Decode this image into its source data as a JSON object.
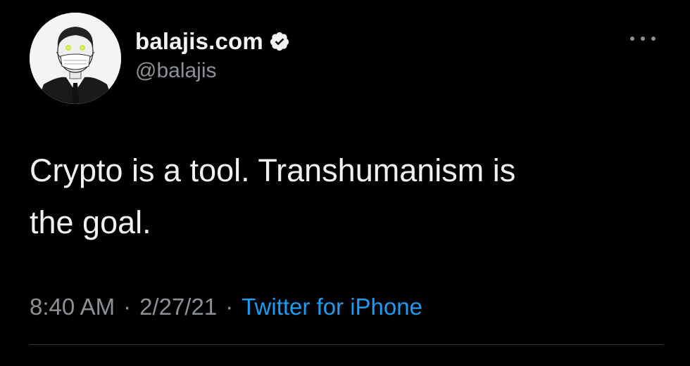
{
  "tweet": {
    "display_name": "balajis.com",
    "handle": "@balajis",
    "verified": true,
    "text_line1": "Crypto is a tool. Transhumanism is",
    "text_line2": "the goal.",
    "time": "8:40 AM",
    "date": "2/27/21",
    "separator": "·",
    "source": "Twitter for iPhone"
  },
  "icons": {
    "avatar": "avatar-illustration",
    "verified": "verified-badge-icon",
    "more": "more-options-icon"
  },
  "colors": {
    "background": "#000000",
    "primary_text": "#eef0f1",
    "secondary_text": "#8b9196",
    "link": "#1d9bf0",
    "divider": "#2f3336"
  }
}
